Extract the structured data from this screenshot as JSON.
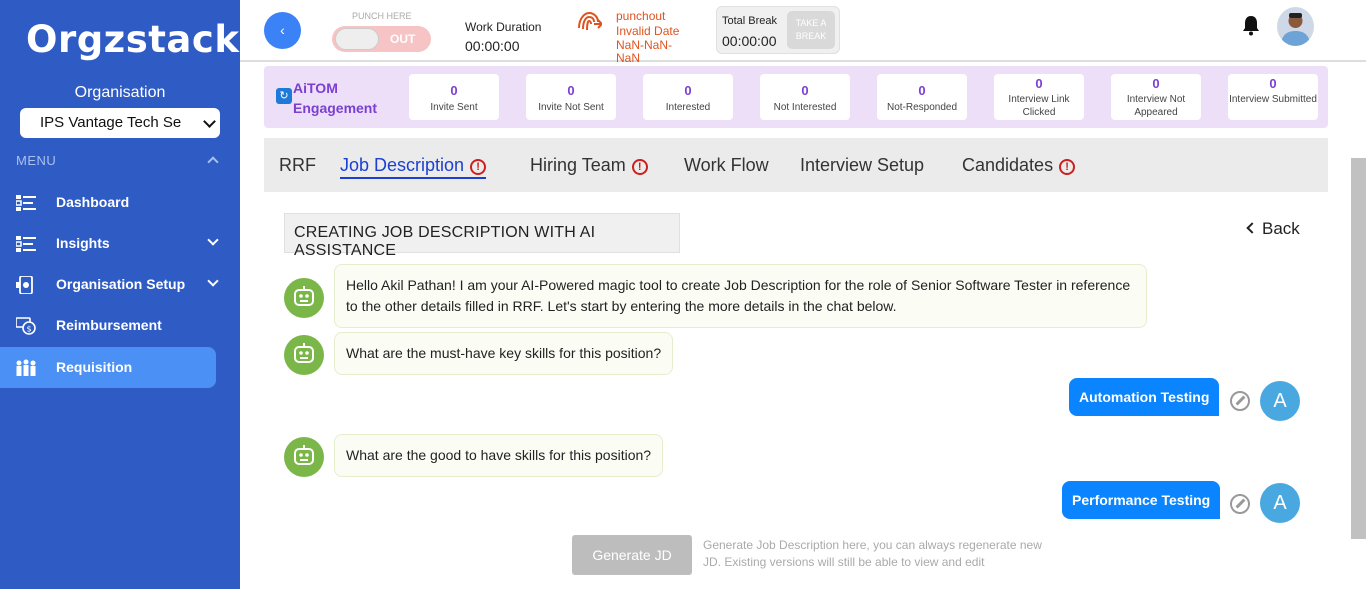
{
  "brand": {
    "logo_text": "Orgzstack"
  },
  "sidebar": {
    "org_label": "Organisation",
    "org_selected": "IPS Vantage Tech Se",
    "menu_label": "MENU",
    "items": [
      {
        "label": "Dashboard",
        "icon": "dashboard-list-icon"
      },
      {
        "label": "Insights",
        "icon": "insights-list-icon"
      },
      {
        "label": "Organisation Setup",
        "icon": "organisation-setup-icon"
      },
      {
        "label": "Reimbursement",
        "icon": "reimbursement-icon"
      },
      {
        "label": "Requisition",
        "icon": "requisition-people-icon"
      }
    ],
    "active_item": "Requisition"
  },
  "topbar": {
    "punch_label": "PUNCH HERE",
    "toggle_text": "OUT",
    "work_duration_label": "Work Duration",
    "work_duration_value": "00:00:00",
    "punchout_lines": [
      "punchout",
      "Invalid Date",
      "NaN-NaN-",
      "NaN"
    ],
    "total_break_label": "Total Break",
    "total_break_value": "00:00:00",
    "take_break_label_1": "TAKE A",
    "take_break_label_2": "BREAK"
  },
  "engagement": {
    "title_line1": "AiTOM",
    "title_line2": "Engagement",
    "stats": [
      {
        "value": "0",
        "label": "Invite Sent"
      },
      {
        "value": "0",
        "label": "Invite Not Sent"
      },
      {
        "value": "0",
        "label": "Interested"
      },
      {
        "value": "0",
        "label": "Not Interested"
      },
      {
        "value": "0",
        "label": "Not-Responded"
      },
      {
        "value": "0",
        "label": "Interview Link Clicked"
      },
      {
        "value": "0",
        "label": "Interview Not Appeared"
      },
      {
        "value": "0",
        "label": "Interview Submitted"
      }
    ]
  },
  "tabs": [
    {
      "label": "RRF",
      "alert": false
    },
    {
      "label": "Job Description",
      "alert": true,
      "active": true
    },
    {
      "label": "Hiring Team",
      "alert": true
    },
    {
      "label": "Work Flow",
      "alert": false
    },
    {
      "label": "Interview Setup",
      "alert": false
    },
    {
      "label": "Candidates",
      "alert": true
    }
  ],
  "content": {
    "heading": "CREATING JOB DESCRIPTION WITH AI ASSISTANCE",
    "back_label": "Back",
    "messages": {
      "bot_intro": "Hello Akil Pathan! I am your AI-Powered magic tool to create Job Description for the role of Senior Software Tester in reference to the other details filled in RRF. Let's start by entering the more details in the chat below.",
      "bot_q1": "What are the must-have key skills for this position?",
      "user_a1": "Automation Testing",
      "bot_q2": "What are the good to have skills for this position?",
      "user_a2": "Performance Testing"
    },
    "user_initial": "A",
    "generate_button": "Generate JD",
    "generate_hint": "Generate Job Description here, you can always regenerate new JD. Existing versions will still be able to view and edit"
  },
  "colors": {
    "sidebar": "#2f5bc4",
    "active_nav": "#4a90f5",
    "accent_purple": "#7b3fd1",
    "user_bubble": "#0a84ff",
    "bot_avatar": "#7ab648",
    "alert_red": "#cc1f1f"
  }
}
